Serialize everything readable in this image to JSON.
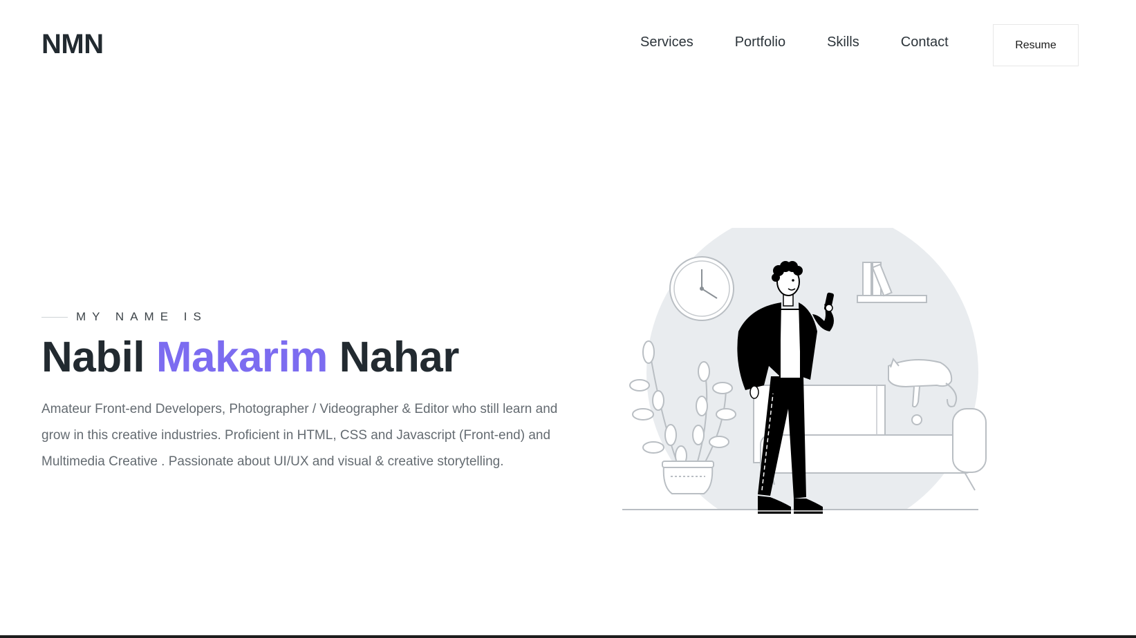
{
  "header": {
    "logo": "NMN",
    "nav": [
      {
        "label": "Services"
      },
      {
        "label": "Portfolio"
      },
      {
        "label": "Skills"
      },
      {
        "label": "Contact"
      }
    ],
    "resume_label": "Resume"
  },
  "hero": {
    "eyebrow": "MY NAME IS",
    "name_first": "Nabil",
    "name_middle": "Makarim",
    "name_last": "Nahar",
    "description": "Amateur Front-end Developers, Photographer / Videographer & Editor who still learn and grow in this creative industries. Proficient in HTML, CSS and Javascript (Front-end) and Multimedia Creative . Passionate about UI/UX and visual & creative storytelling."
  },
  "colors": {
    "accent": "#7c6cf0",
    "text_dark": "#222a30",
    "text_muted": "#646b71",
    "illustration_bg": "#e9ecef"
  },
  "icons": {
    "illustration": "person-with-phone-illustration",
    "clock": "wall-clock-icon",
    "plant": "potted-plant-icon",
    "cat": "sleeping-cat-icon"
  }
}
